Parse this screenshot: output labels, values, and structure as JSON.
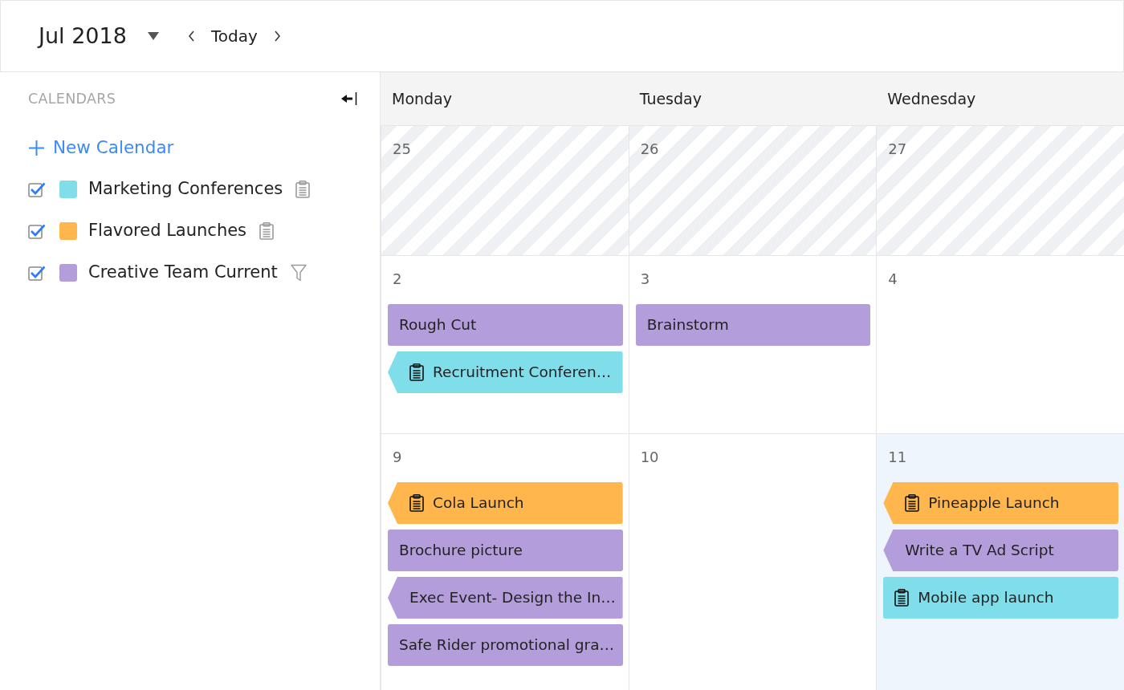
{
  "toolbar": {
    "month": "Jul 2018",
    "today": "Today"
  },
  "sidebar": {
    "heading": "CALENDARS",
    "new_calendar": "New Calendar",
    "calendars": [
      {
        "name": "Marketing Conferences",
        "color": "#80deea",
        "checked": true,
        "kind": "clipboard"
      },
      {
        "name": "Flavored Launches",
        "color": "#ffb74d",
        "checked": true,
        "kind": "clipboard"
      },
      {
        "name": "Creative Team Current",
        "color": "#b39ddb",
        "checked": true,
        "kind": "filter"
      }
    ]
  },
  "calendar": {
    "weekdays": [
      "Monday",
      "Tuesday",
      "Wednesday"
    ],
    "weeks": [
      {
        "days": [
          {
            "date": "25",
            "outside_month": true,
            "today": false
          },
          {
            "date": "26",
            "outside_month": true,
            "today": false
          },
          {
            "date": "27",
            "outside_month": true,
            "today": false
          }
        ]
      },
      {
        "days": [
          {
            "date": "2",
            "outside_month": false,
            "today": false,
            "events": [
              {
                "title": "Rough Cut",
                "color": "#b39ddb",
                "continued": false,
                "note": false
              },
              {
                "title": "Recruitment Conferen…",
                "color": "#80deea",
                "continued": true,
                "note": true
              }
            ]
          },
          {
            "date": "3",
            "outside_month": false,
            "today": false,
            "events": [
              {
                "title": "Brainstorm",
                "color": "#b39ddb",
                "continued": false,
                "note": false
              }
            ]
          },
          {
            "date": "4",
            "outside_month": false,
            "today": false
          }
        ]
      },
      {
        "days": [
          {
            "date": "9",
            "outside_month": false,
            "today": false,
            "events": [
              {
                "title": "Cola Launch",
                "color": "#ffb74d",
                "continued": true,
                "note": true
              },
              {
                "title": "Brochure picture",
                "color": "#b39ddb",
                "continued": false,
                "note": false
              },
              {
                "title": "Exec Event- Design the In…",
                "color": "#b39ddb",
                "continued": true,
                "note": false
              },
              {
                "title": "Safe Rider promotional gra…",
                "color": "#b39ddb",
                "continued": false,
                "note": false
              }
            ]
          },
          {
            "date": "10",
            "outside_month": false,
            "today": false
          },
          {
            "date": "11",
            "outside_month": false,
            "today": true,
            "events": [
              {
                "title": "Pineapple Launch",
                "color": "#ffb74d",
                "continued": true,
                "note": true
              },
              {
                "title": "Write a TV Ad Script",
                "color": "#b39ddb",
                "continued": true,
                "note": false
              },
              {
                "title": "Mobile app launch",
                "color": "#80deea",
                "continued": false,
                "note": true
              }
            ]
          }
        ]
      }
    ]
  }
}
